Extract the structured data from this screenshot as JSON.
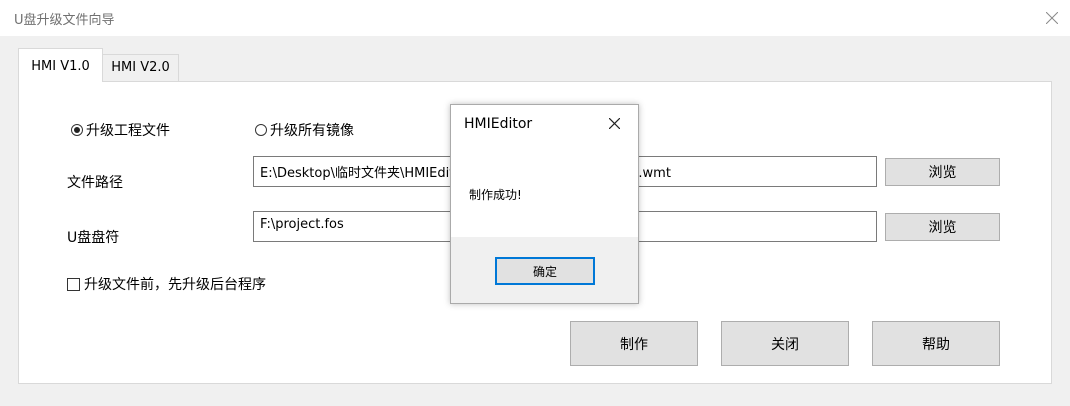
{
  "window": {
    "title": "U盘升级文件向导",
    "close_icon": "close-icon"
  },
  "tabs": [
    {
      "label": "HMI V1.0",
      "active": true
    },
    {
      "label": "HMI V2.0",
      "active": false
    }
  ],
  "form": {
    "mode_options": [
      {
        "label": "升级工程文件",
        "selected": true
      },
      {
        "label": "升级所有镜像",
        "selected": false
      }
    ],
    "file_path": {
      "label": "文件路径",
      "value": "E:\\Desktop\\临时文件夹\\HMIEditor_Project\\HMI_Project_0305.wmt",
      "browse_label": "浏览"
    },
    "udisk": {
      "label": "U盘盘符",
      "value": "F:\\project.fos",
      "browse_label": "浏览"
    },
    "upgrade_backend": {
      "label": "升级文件前，先升级后台程序",
      "checked": false
    }
  },
  "actions": {
    "make_label": "制作",
    "close_label": "关闭",
    "help_label": "帮助"
  },
  "dialog": {
    "title": "HMIEditor",
    "message": "制作成功!",
    "ok_label": "确定"
  },
  "colors": {
    "accent": "#0078d7",
    "window_bg": "#f0f0f0",
    "button_bg": "#e1e1e1"
  }
}
